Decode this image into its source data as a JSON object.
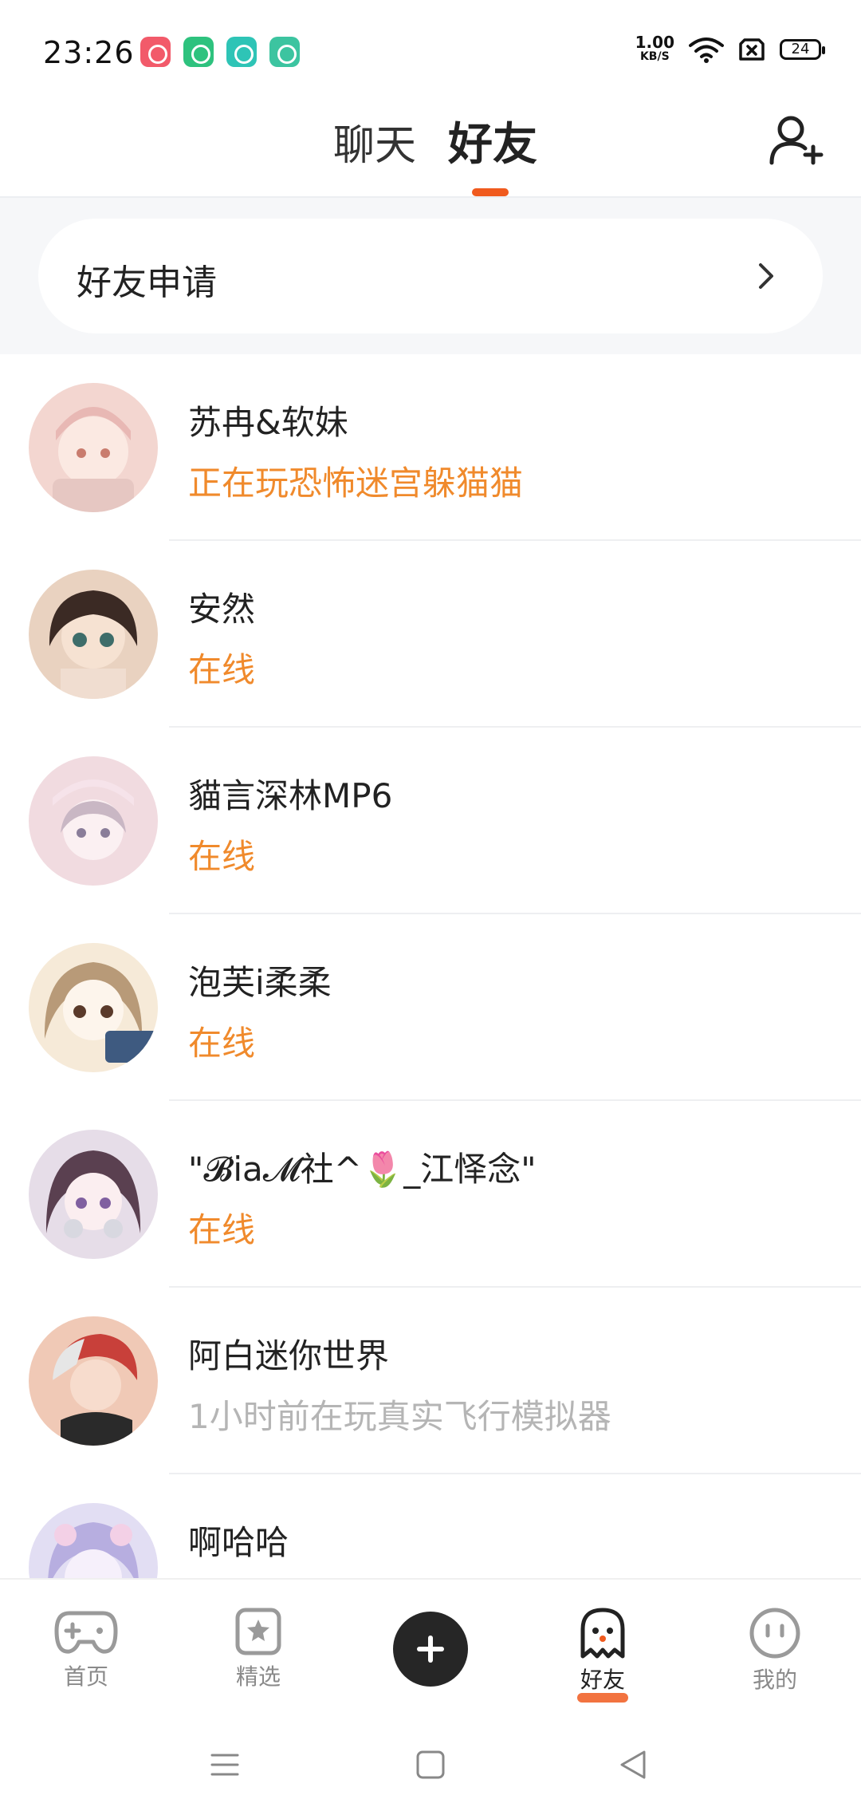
{
  "status_bar": {
    "time": "23:26",
    "net_speed_value": "1.00",
    "net_speed_unit": "KB/S",
    "battery": "24",
    "app_icon_colors": [
      "#f25a6a",
      "#2ec27e",
      "#2ec4b6",
      "#3cc4a0"
    ]
  },
  "header": {
    "tabs": [
      {
        "label": "聊天",
        "active": false
      },
      {
        "label": "好友",
        "active": true
      }
    ],
    "add_friend_icon": "add-user-icon"
  },
  "friend_request": {
    "label": "好友申请"
  },
  "friends": [
    {
      "name": "苏冉&软妹",
      "status": "正在玩恐怖迷宫躲猫猫",
      "status_type": "playing",
      "avatar_colors": [
        "#f3d6d0",
        "#e8b8b4"
      ]
    },
    {
      "name": "安然",
      "status": "在线",
      "status_type": "online",
      "avatar_colors": [
        "#e9d2c0",
        "#3b2a24"
      ]
    },
    {
      "name": "貓言深林MP6",
      "status": "在线",
      "status_type": "online",
      "avatar_colors": [
        "#f1dbe0",
        "#c9b7c4"
      ]
    },
    {
      "name": "泡芙i柔柔",
      "status": "在线",
      "status_type": "online",
      "avatar_colors": [
        "#f6ead8",
        "#b89a78"
      ]
    },
    {
      "name": "\"𝓑ia𝓜社^🌷_江怿念\"",
      "status": "在线",
      "status_type": "online",
      "avatar_colors": [
        "#e6dde8",
        "#5a4050"
      ]
    },
    {
      "name": "阿白迷你世界",
      "status": "1小时前在玩真实飞行模拟器",
      "status_type": "offline",
      "avatar_colors": [
        "#f0c9b6",
        "#2a2a2a"
      ]
    },
    {
      "name": "啊哈哈",
      "status": "",
      "status_type": "offline",
      "avatar_colors": [
        "#e2def3",
        "#b7aee0"
      ]
    }
  ],
  "bottom_nav": {
    "items": [
      {
        "label": "首页",
        "icon": "gamepad-icon",
        "active": false
      },
      {
        "label": "精选",
        "icon": "star-bookmark-icon",
        "active": false
      },
      {
        "label": "",
        "icon": "plus-icon",
        "active": false
      },
      {
        "label": "好友",
        "icon": "ghost-icon",
        "active": true
      },
      {
        "label": "我的",
        "icon": "face-icon",
        "active": false
      }
    ],
    "accent_color": "#f05a1e"
  },
  "system_nav": {
    "buttons": [
      "menu-icon",
      "home-icon",
      "back-icon"
    ]
  }
}
